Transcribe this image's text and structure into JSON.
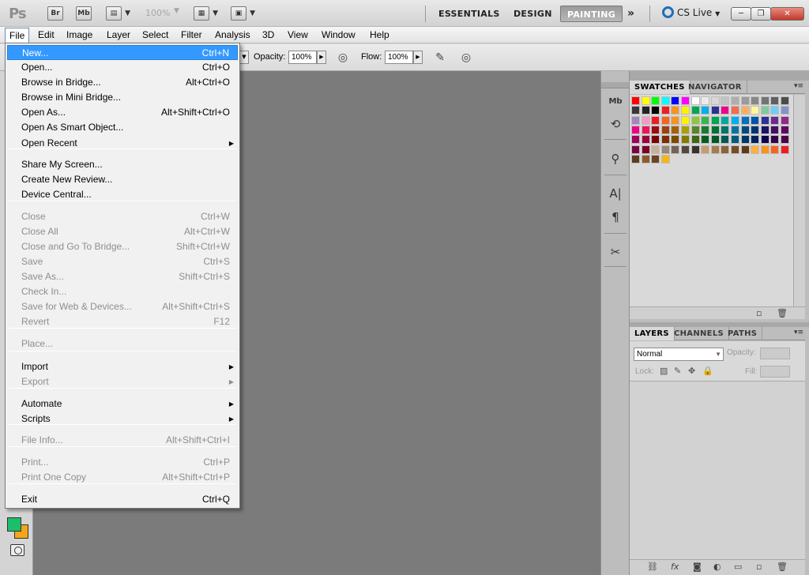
{
  "appbar": {
    "logo": "Ps",
    "buttons": [
      {
        "label": "Br",
        "icon": "bridge-icon"
      },
      {
        "label": "Mb",
        "icon": "mini-bridge-icon"
      },
      {
        "label": "",
        "icon": "view-extras-icon"
      },
      {
        "label": "",
        "icon": "arrange-documents-icon"
      },
      {
        "label": "",
        "icon": "screen-mode-icon"
      }
    ],
    "zoom": "100%",
    "workspaces": [
      "ESSENTIALS",
      "DESIGN",
      "PAINTING"
    ],
    "active_workspace": "PAINTING",
    "overflow": "»",
    "cs_live": "CS Live",
    "window_controls": {
      "minimize": "─",
      "restore": "❐",
      "close": "✕"
    }
  },
  "menubar": {
    "items": [
      "File",
      "Edit",
      "Image",
      "Layer",
      "Select",
      "Filter",
      "Analysis",
      "3D",
      "View",
      "Window",
      "Help"
    ],
    "open_menu": "File"
  },
  "options": {
    "opacity_label": "Opacity:",
    "opacity_value": "100%",
    "flow_label": "Flow:",
    "flow_value": "100%"
  },
  "file_menu": {
    "items": [
      {
        "label": "New...",
        "shortcut": "Ctrl+N",
        "enabled": true,
        "highlighted": true
      },
      {
        "label": "Open...",
        "shortcut": "Ctrl+O",
        "enabled": true
      },
      {
        "label": "Browse in Bridge...",
        "shortcut": "Alt+Ctrl+O",
        "enabled": true
      },
      {
        "label": "Browse in Mini Bridge...",
        "shortcut": "",
        "enabled": true
      },
      {
        "label": "Open As...",
        "shortcut": "Alt+Shift+Ctrl+O",
        "enabled": true
      },
      {
        "label": "Open As Smart Object...",
        "shortcut": "",
        "enabled": true
      },
      {
        "label": "Open Recent",
        "shortcut": "",
        "enabled": true,
        "submenu": true
      },
      {
        "label": "Share My Screen...",
        "shortcut": "",
        "enabled": true
      },
      {
        "label": "Create New Review...",
        "shortcut": "",
        "enabled": true
      },
      {
        "label": "Device Central...",
        "shortcut": "",
        "enabled": true
      },
      {
        "label": "Close",
        "shortcut": "Ctrl+W",
        "enabled": false
      },
      {
        "label": "Close All",
        "shortcut": "Alt+Ctrl+W",
        "enabled": false
      },
      {
        "label": "Close and Go To Bridge...",
        "shortcut": "Shift+Ctrl+W",
        "enabled": false
      },
      {
        "label": "Save",
        "shortcut": "Ctrl+S",
        "enabled": false
      },
      {
        "label": "Save As...",
        "shortcut": "Shift+Ctrl+S",
        "enabled": false
      },
      {
        "label": "Check In...",
        "shortcut": "",
        "enabled": false
      },
      {
        "label": "Save for Web & Devices...",
        "shortcut": "Alt+Shift+Ctrl+S",
        "enabled": false
      },
      {
        "label": "Revert",
        "shortcut": "F12",
        "enabled": false
      },
      {
        "label": "Place...",
        "shortcut": "",
        "enabled": false
      },
      {
        "label": "Import",
        "shortcut": "",
        "enabled": true,
        "submenu": true
      },
      {
        "label": "Export",
        "shortcut": "",
        "enabled": false,
        "submenu": true
      },
      {
        "label": "Automate",
        "shortcut": "",
        "enabled": true,
        "submenu": true
      },
      {
        "label": "Scripts",
        "shortcut": "",
        "enabled": true,
        "submenu": true
      },
      {
        "label": "File Info...",
        "shortcut": "Alt+Shift+Ctrl+I",
        "enabled": false
      },
      {
        "label": "Print...",
        "shortcut": "Ctrl+P",
        "enabled": false
      },
      {
        "label": "Print One Copy",
        "shortcut": "Alt+Shift+Ctrl+P",
        "enabled": false
      },
      {
        "label": "Exit",
        "shortcut": "Ctrl+Q",
        "enabled": true
      }
    ]
  },
  "swatches_panel": {
    "tabs": [
      "SWATCHES",
      "NAVIGATOR"
    ],
    "active_tab": "SWATCHES",
    "colors": [
      [
        "#ff0000",
        "#ffff00",
        "#00ff00",
        "#00ffff",
        "#0000ff",
        "#ff00ff",
        "#ffffff",
        "#ebebeb",
        "#d7d7d7",
        "#c3c3c3",
        "#afafaf",
        "#9b9b9b",
        "#878787",
        "#737373",
        "#5f5f5f",
        "#4b4b4b"
      ],
      [
        "#373737",
        "#232323",
        "#000000",
        "#ee1d24",
        "#f7941d",
        "#fff200",
        "#00a651",
        "#00aeef",
        "#2e3192",
        "#ec008c",
        "#f26c4f",
        "#fbaf5d",
        "#fff799",
        "#82ca9c",
        "#6dcff6",
        "#8393ca"
      ],
      [
        "#a186be",
        "#f49ac2",
        "#ed1c24",
        "#f26522",
        "#f7941d",
        "#fff200",
        "#8dc63f",
        "#39b54a",
        "#00a651",
        "#00a99d",
        "#00aeef",
        "#0072bc",
        "#0054a6",
        "#2e3192",
        "#662d91",
        "#92278f"
      ],
      [
        "#ec008c",
        "#ed145b",
        "#9e0b0f",
        "#a0410d",
        "#a36209",
        "#aba000",
        "#598527",
        "#1a7b30",
        "#007236",
        "#00746b",
        "#0076a3",
        "#004b80",
        "#003471",
        "#1b1464",
        "#440e62",
        "#630460"
      ],
      [
        "#9e005d",
        "#9e0039",
        "#790000",
        "#7b2e00",
        "#7d4900",
        "#827b00",
        "#406618",
        "#005e20",
        "#005826",
        "#005952",
        "#005b7f",
        "#003663",
        "#002157",
        "#0d004c",
        "#32004b",
        "#4b0049"
      ],
      [
        "#7b0046",
        "#7a0026",
        "#c7b299",
        "#998675",
        "#736357",
        "#534741",
        "#37302d",
        "#c69c6d",
        "#a67c52",
        "#8c6239",
        "#754c24",
        "#603913",
        "#fbb040",
        "#f7941d",
        "#f26522",
        "#ed1c24"
      ]
    ],
    "last_row_count": 4
  },
  "layers_panel": {
    "tabs": [
      "LAYERS",
      "CHANNELS",
      "PATHS"
    ],
    "active_tab": "LAYERS",
    "blend_mode": "Normal",
    "opacity_label": "Opacity:",
    "lock_label": "Lock:",
    "fill_label": "Fill:"
  },
  "tool_colors": {
    "foreground": "#1bbf6b",
    "background": "#f5a51a"
  }
}
